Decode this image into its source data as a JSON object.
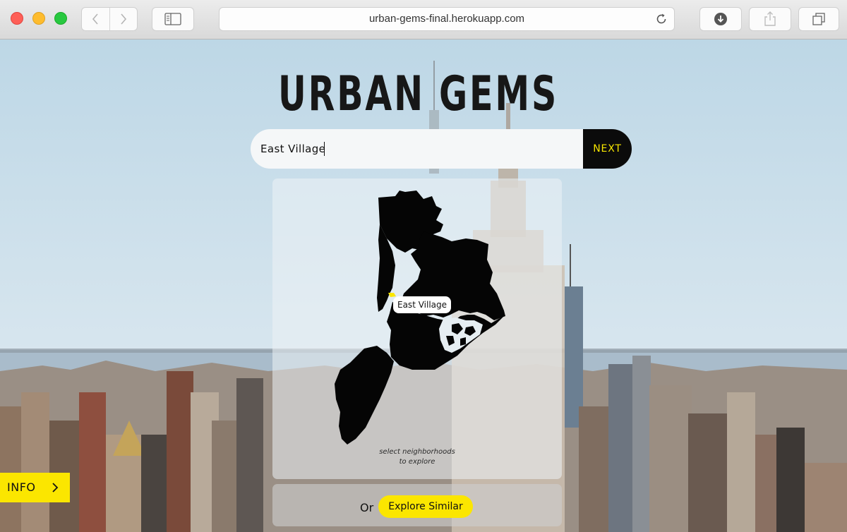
{
  "browser": {
    "url": "urban-gems-final.herokuapp.com",
    "icons": {
      "back": "chevron-left-icon",
      "forward": "chevron-right-icon",
      "sidebar": "sidebar-icon",
      "reload": "reload-icon",
      "download": "download-icon",
      "share": "share-icon",
      "tabs": "tabs-icon"
    }
  },
  "app": {
    "logo": "URBAN GEMS",
    "search": {
      "value": "East Village",
      "next_label": "NEXT"
    },
    "map": {
      "selected_neighborhood": "East Village",
      "hint_lines": [
        "select neighborhoods",
        "to explore"
      ],
      "highlight_color": "#fbe600"
    },
    "or_label": "Or",
    "explore_similar_label": "Explore Similar",
    "info_label": "INFO"
  },
  "colors": {
    "accent_yellow": "#fbe600",
    "dark": "#0b0b0b",
    "next_text": "#f7e600"
  }
}
